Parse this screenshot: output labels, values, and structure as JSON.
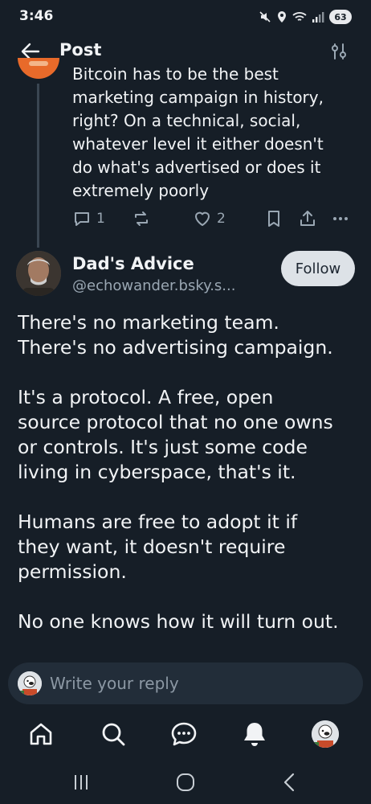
{
  "status_bar": {
    "time": "3:46",
    "battery": "63"
  },
  "header": {
    "title": "Post"
  },
  "parent_post": {
    "text": "Bitcoin has to be the best\nmarketing campaign in history,\nright? On a technical, social,\nwhatever level it either doesn't\ndo what's advertised or does it\nextremely poorly",
    "reply_count": "1",
    "like_count": "2"
  },
  "post": {
    "author_name": "Dad's Advice",
    "author_handle": "@echowander.bsky.s...",
    "follow_label": "Follow",
    "paragraphs": [
      "There's no marketing team.\nThere's no advertising campaign.",
      "It's a protocol. A free, open\nsource protocol that no one owns\nor controls. It's just some code\nliving in cyberspace, that's it.",
      "Humans are free to adopt it if\nthey want, it doesn't require\npermission.",
      "No one knows how it will turn out."
    ]
  },
  "reply": {
    "placeholder": "Write your reply"
  },
  "colors": {
    "background": "#161e27",
    "text": "#f1f3f5",
    "muted": "#9aa7b3",
    "follow_bg": "#dde2e7"
  },
  "icons": [
    "back-arrow-icon",
    "filter-icon",
    "reply-icon",
    "repost-icon",
    "heart-icon",
    "bookmark-icon",
    "share-icon",
    "more-icon",
    "home-icon",
    "search-icon",
    "chat-icon",
    "bell-icon"
  ]
}
